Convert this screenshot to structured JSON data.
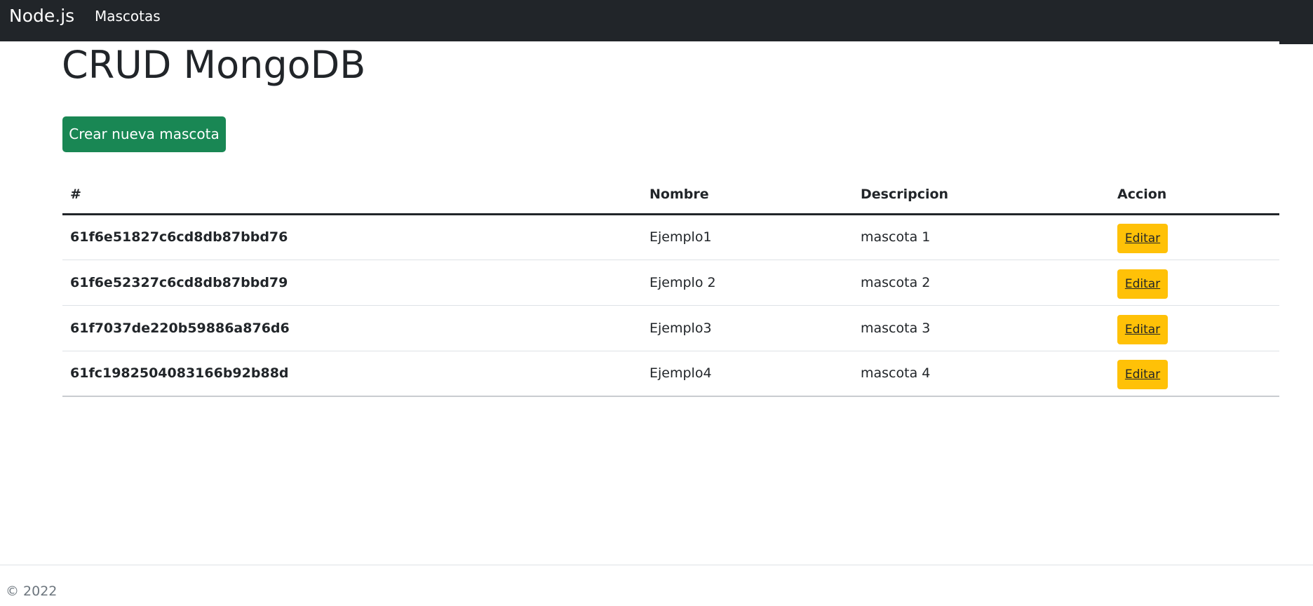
{
  "navbar": {
    "brand": "Node.js",
    "links": [
      "Mascotas"
    ]
  },
  "page": {
    "title": "CRUD MongoDB",
    "create_button": "Crear nueva mascota"
  },
  "table": {
    "headers": [
      "#",
      "Nombre",
      "Descripcion",
      "Accion"
    ],
    "rows": [
      {
        "id": "61f6e51827c6cd8db87bbd76",
        "nombre": "Ejemplo1",
        "descripcion": "mascota 1",
        "action": "Editar"
      },
      {
        "id": "61f6e52327c6cd8db87bbd79",
        "nombre": "Ejemplo 2",
        "descripcion": "mascota 2",
        "action": "Editar"
      },
      {
        "id": "61f7037de220b59886a876d6",
        "nombre": "Ejemplo3",
        "descripcion": "mascota 3",
        "action": "Editar"
      },
      {
        "id": "61fc1982504083166b92b88d",
        "nombre": "Ejemplo4",
        "descripcion": "mascota 4",
        "action": "Editar"
      }
    ]
  },
  "footer": {
    "text": "© 2022"
  },
  "colors": {
    "navbar_bg": "#212529",
    "success": "#198754",
    "warning": "#ffc107",
    "muted": "#6c757d"
  }
}
